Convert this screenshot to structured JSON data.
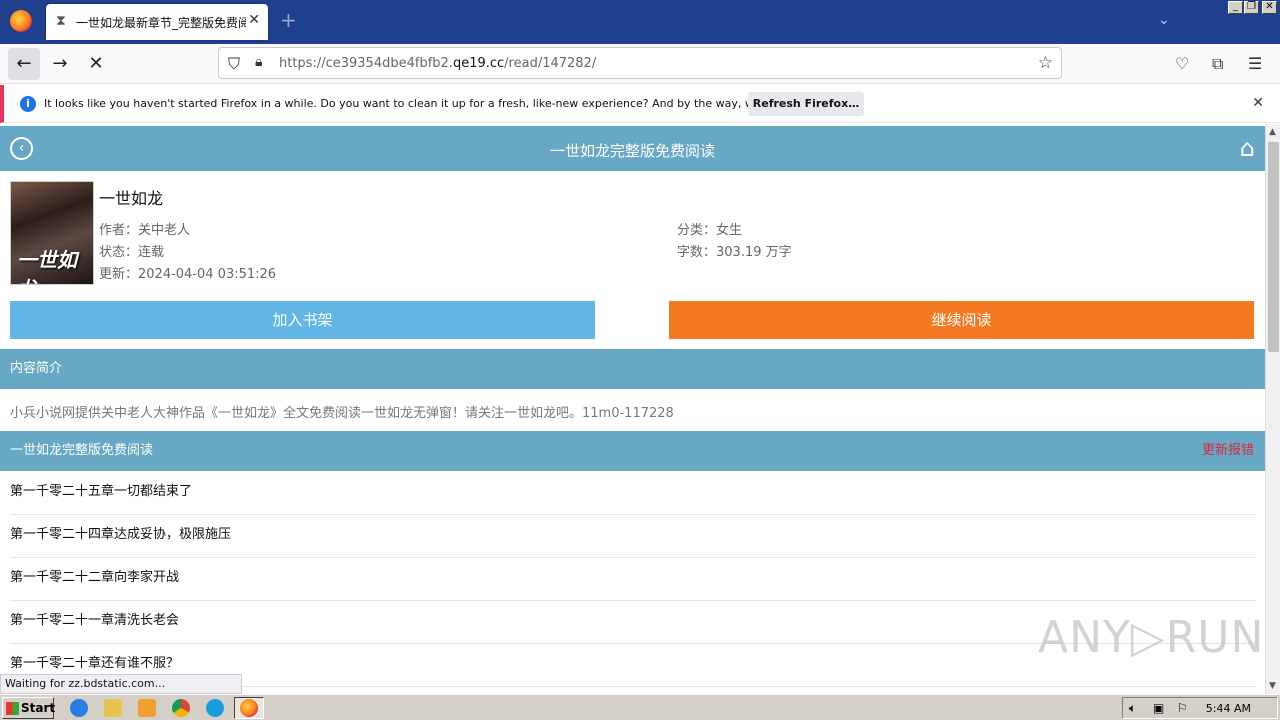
{
  "browser": {
    "tab_title": "一世如龙最新章节_完整版免费阅读",
    "url_prefix": "https://ce39354dbe4fbfb2.",
    "url_domain": "qe19.cc",
    "url_path": "/read/147282/",
    "notification": "It looks like you haven't started Firefox in a while. Do you want to clean it up for a fresh, like-new experience? And by the way, welcome back!",
    "refresh_label": "Refresh Firefox…",
    "status": "Waiting for zz.bdstatic.com..."
  },
  "page": {
    "header_title": "一世如龙完整版免费阅读",
    "book": {
      "title": "一世如龙",
      "cover_text": "一世如龙",
      "author": "作者：关中老人",
      "category": "分类：女生",
      "status": "状态：连载",
      "word_count": "字数：303.19 万字",
      "updated": "更新：2024-04-04 03:51:26"
    },
    "add_shelf_label": "加入书架",
    "continue_label": "继续阅读",
    "intro_heading": "内容简介",
    "intro_text": "小兵小说网提供关中老人大神作品《一世如龙》全文免费阅读一世如龙无弹窗！请关注一世如龙吧。11m0-117228",
    "chapters_heading": "一世如龙完整版免费阅读",
    "report_label": "更新报错",
    "chapters": [
      "第一千零二十五章一切都结束了",
      "第一千零二十四章达成妥协，极限施压",
      "第一千零二十二章向李家开战",
      "第一千零二十一章清洗长老会",
      "第一千零二十章还有谁不服？"
    ],
    "watermark": "ANY▷RUN"
  },
  "taskbar": {
    "start_label": "Start",
    "clock": "5:44 AM"
  },
  "colors": {
    "header_bg": "#67a9c4",
    "shelf_btn": "#61b6e6",
    "continue_btn": "#f47920",
    "report": "#d8283a"
  }
}
